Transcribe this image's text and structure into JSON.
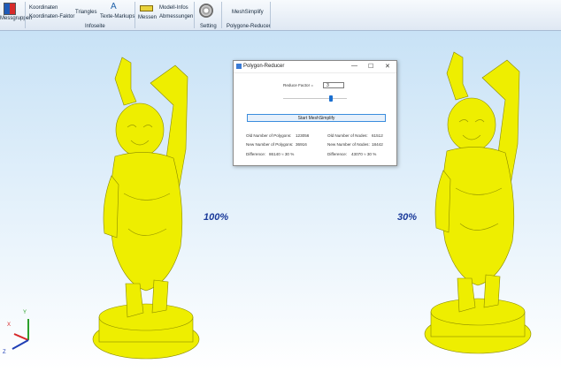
{
  "ribbon": {
    "tab_messgruppen": "Messgruppen",
    "koordinaten": "Koordinaten",
    "koordinaten_faktor": "Koordinaten-Faktor",
    "triangles": "Triangles",
    "texte_markups": "Texte-Markups",
    "messen": "Messen",
    "modell_infos": "Modell-Infos",
    "abmessungen": "Abmessungen",
    "meshsimplify": "MeshSimplify",
    "group_infoseite": "Infoseite",
    "group_setting": "Setting",
    "group_polygone": "Polygone-Reducer"
  },
  "viewport": {
    "left_label": "100%",
    "right_label": "30%",
    "axis_x": "X",
    "axis_y": "Y",
    "axis_z": "Z",
    "model_color": "#f0f000"
  },
  "dialog": {
    "title": "Polygon-Reducer",
    "minimize": "—",
    "maximize": "☐",
    "close": "✕",
    "reduce_label": "Reduce Factor =",
    "reduce_value": "3",
    "slider_value_percent": 70,
    "start_button": "Start MeshSimplify",
    "old_polygons": "Old Number of Polygons:",
    "old_polygons_val": "123056",
    "new_polygons": "New Number of Polygons:",
    "new_polygons_val": "36916",
    "difference_left": "Difference:",
    "difference_left_val": "86140 ≈ 30 %",
    "old_nodes": "Old Number of Nodes:",
    "old_nodes_val": "61512",
    "new_nodes": "New Number of Nodes:",
    "new_nodes_val": "18442",
    "difference_right": "Difference:",
    "difference_right_val": "43070 ≈ 30 %"
  }
}
